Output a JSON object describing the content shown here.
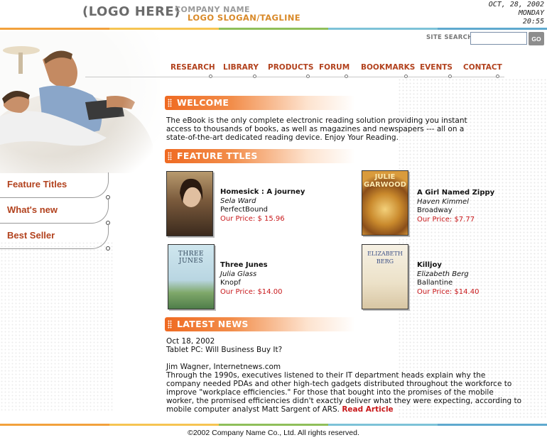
{
  "header": {
    "logo": "(LOGO HERE)",
    "company_name": "COMPANY NAME",
    "slogan": "LOGO SLOGAN/TAGLINE",
    "date": "OCT, 28, 2002",
    "day": "MONDAY",
    "time": "20:55"
  },
  "search": {
    "label": "SITE SEARCH",
    "value": "",
    "go_label": "GO"
  },
  "nav": [
    "RESEARCH",
    "LIBRARY",
    "PRODUCTS",
    "FORUM",
    "BOOKMARKS",
    "EVENTS",
    "CONTACT"
  ],
  "left_menu": [
    "Feature Titles",
    "What's new",
    "Best Seller"
  ],
  "welcome": {
    "heading": "WELCOME",
    "line1": "The eBook is the only complete electronic reading solution providing you instant",
    "line2": "access to thousands of books, as well as magazines and newspapers --- all on a",
    "line3": "state-of-the-art dedicated reading device. Enjoy Your Reading."
  },
  "features": {
    "heading": "FEATURE TTLES",
    "books": [
      {
        "title": "Homesick : A journey",
        "author": "Sela Ward",
        "publisher": "PerfectBound",
        "price": "Our Price: $ 15.96",
        "cover_text": ""
      },
      {
        "title": "A Girl Named Zippy",
        "author": "Haven Kimmel",
        "publisher": "Broadway",
        "price": "Our Price: $7.77",
        "cover_text": "JULIE GARWOOD"
      },
      {
        "title": "Three Junes",
        "author": "Julia Glass",
        "publisher": "Knopf",
        "price": "Our Price: $14.00",
        "cover_text": "THREE JUNES"
      },
      {
        "title": "Killjoy",
        "author": "Elizabeth Berg",
        "publisher": "Ballantine",
        "price": "Our Price: $14.40",
        "cover_text": "ELIZABETH BERG"
      }
    ]
  },
  "news": {
    "heading": "LATEST NEWS",
    "date": "Oct 18, 2002",
    "headline": "Tablet PC: Will Business Buy It?",
    "byline": "Jim Wagner, Internetnews.com",
    "l1": "Through the 1990s, executives listened to their IT department heads explain why the",
    "l2": "company needed PDAs and other high-tech gadgets distributed throughout the workforce to",
    "l3": "improve \"workplace efficiencies.\" For those that bought into the promises of the mobile",
    "l4": "worker, the promised efficiencies didn't exactly deliver what they were expecting, according to",
    "l5": "mobile computer analyst Matt Sargent of ARS.",
    "read_more": "Read Article"
  },
  "footer": "©2002 Company Name Co., Ltd. All rights reserved.",
  "colors": {
    "accent": "#b2421e",
    "orange": "#ef6a22",
    "price": "#c8171a"
  }
}
